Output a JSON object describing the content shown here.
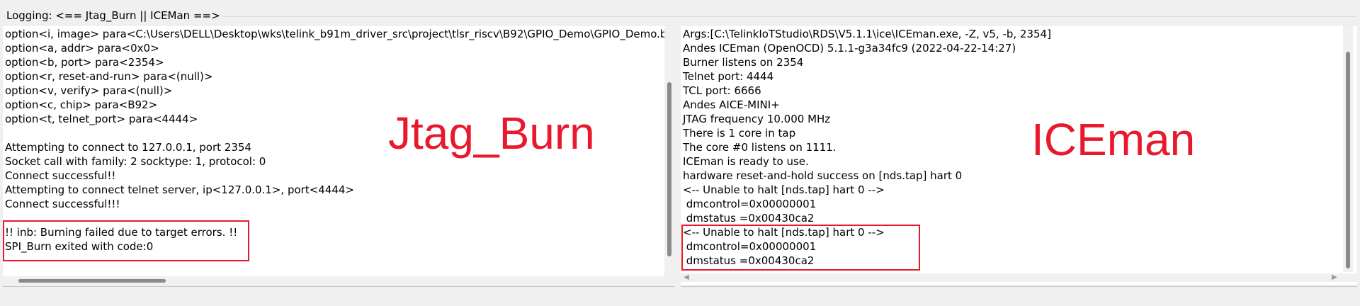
{
  "logging_group": {
    "title": "Logging: <== Jtag_Burn || ICEMan ==>"
  },
  "left_pane": {
    "label": "Jtag_Burn",
    "lines": [
      "option<i, image> para<C:\\Users\\DELL\\Desktop\\wks\\telink_b91m_driver_src\\project\\tlsr_riscv\\B92\\GPIO_Demo\\GPIO_Demo.bir",
      "option<a, addr> para<0x0>",
      "option<b, port> para<2354>",
      "option<r, reset-and-run> para<(null)>",
      "option<v, verify> para<(null)>",
      "option<c, chip> para<B92>",
      "option<t, telnet_port> para<4444>",
      "",
      "Attempting to connect to 127.0.0.1, port 2354",
      "Socket call with family: 2 socktype: 1, protocol: 0",
      "Connect successful!!",
      "Attempting to connect telnet server, ip<127.0.0.1>, port<4444>",
      "Connect successful!!!",
      "",
      "!! inb: Burning failed due to target errors. !!",
      "SPI_Burn exited with code:0"
    ]
  },
  "right_pane": {
    "label": "ICEman",
    "lines": [
      "Args:[C:\\TelinkIoTStudio\\RDS\\V5.1.1\\ice\\ICEman.exe, -Z, v5, -b, 2354]",
      "Andes ICEman (OpenOCD) 5.1.1-g3a34fc9 (2022-04-22-14:27)",
      "Burner listens on 2354",
      "Telnet port: 4444",
      "TCL port: 6666",
      "Andes AICE-MINI+",
      "JTAG frequency 10.000 MHz",
      "There is 1 core in tap",
      "The core #0 listens on 1111.",
      "ICEman is ready to use.",
      "hardware reset-and-hold success on [nds.tap] hart 0",
      "<-- Unable to halt [nds.tap] hart 0 -->",
      " dmcontrol=0x00000001",
      " dmstatus =0x00430ca2",
      "<-- Unable to halt [nds.tap] hart 0 -->",
      " dmcontrol=0x00000001",
      " dmstatus =0x00430ca2"
    ]
  },
  "colors": {
    "annotation_red": "#e8192c"
  },
  "icons": {
    "scroll_left": "scroll-left-arrow-icon",
    "scroll_right": "scroll-right-arrow-icon"
  }
}
